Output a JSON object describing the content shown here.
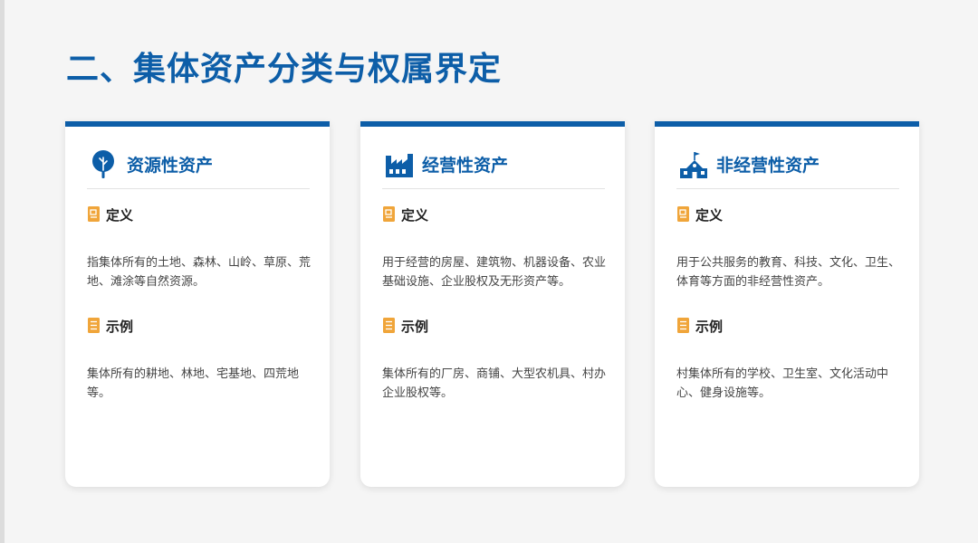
{
  "title": "二、集体资产分类与权属界定",
  "colors": {
    "primary": "#0d5ea8",
    "accent": "#f0a53a"
  },
  "cards": [
    {
      "icon": "tree-icon",
      "title": "资源性资产",
      "definition_label": "定义",
      "definition": "指集体所有的土地、森林、山岭、草原、荒地、滩涂等自然资源。",
      "example_label": "示例",
      "example": "集体所有的耕地、林地、宅基地、四荒地等。"
    },
    {
      "icon": "factory-icon",
      "title": "经营性资产",
      "definition_label": "定义",
      "definition": "用于经营的房屋、建筑物、机器设备、农业基础设施、企业股权及无形资产等。",
      "example_label": "示例",
      "example": "集体所有的厂房、商铺、大型农机具、村办企业股权等。"
    },
    {
      "icon": "school-icon",
      "title": "非经营性资产",
      "definition_label": "定义",
      "definition": "用于公共服务的教育、科技、文化、卫生、体育等方面的非经营性资产。",
      "example_label": "示例",
      "example": "村集体所有的学校、卫生室、文化活动中心、健身设施等。"
    }
  ]
}
